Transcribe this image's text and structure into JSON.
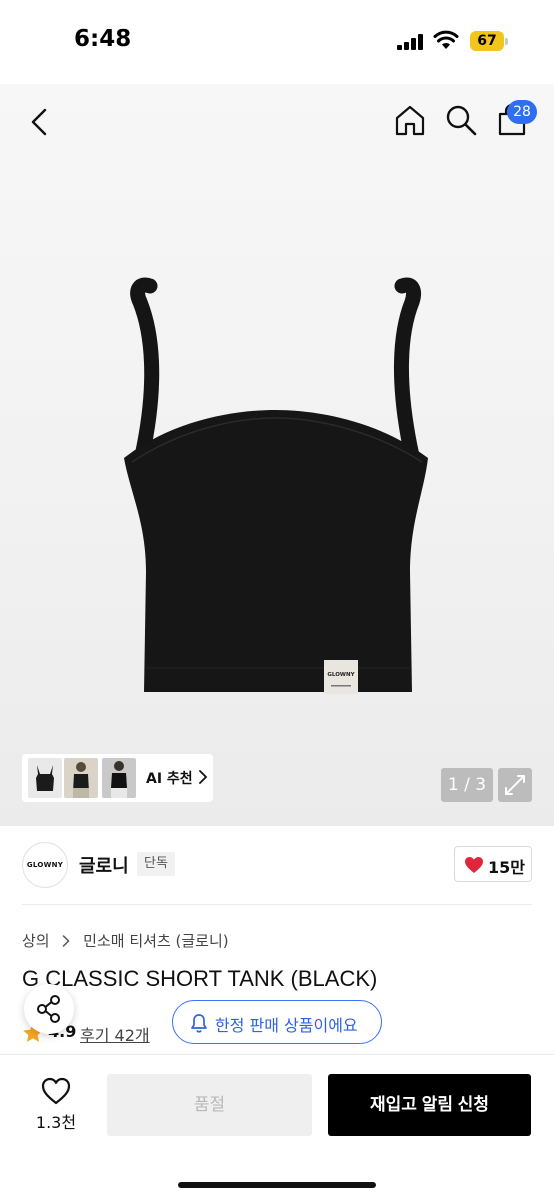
{
  "status_bar": {
    "time": "6:48",
    "battery": "67"
  },
  "header": {
    "cart_count": "28",
    "icons": [
      "chevron-left-icon",
      "home-icon",
      "search-icon",
      "shopping-bag-icon"
    ]
  },
  "gallery": {
    "ai_label": "AI 추천",
    "page_counter": "1 / 3",
    "label_text": "GLOWNY"
  },
  "seller": {
    "logo_text": "GLOWNY",
    "name": "글로니",
    "badge": "단독",
    "likes": "15만"
  },
  "breadcrumb": [
    "상의",
    "민소매 티셔츠 (글로니)"
  ],
  "product": {
    "title": "G CLASSIC SHORT TANK (BLACK)",
    "rating": "4.9",
    "reviews": "후기 42개",
    "limited_notice": "한정 판매 상품이에요"
  },
  "bottom_bar": {
    "wish_count": "1.3천",
    "soldout_label": "품절",
    "restock_label": "재입고 알림 신청"
  },
  "colors": {
    "accent": "#2f6ef0",
    "badge_yellow": "#f2c51b",
    "heart_red": "#e0263a",
    "star_orange": "#f5a623"
  }
}
